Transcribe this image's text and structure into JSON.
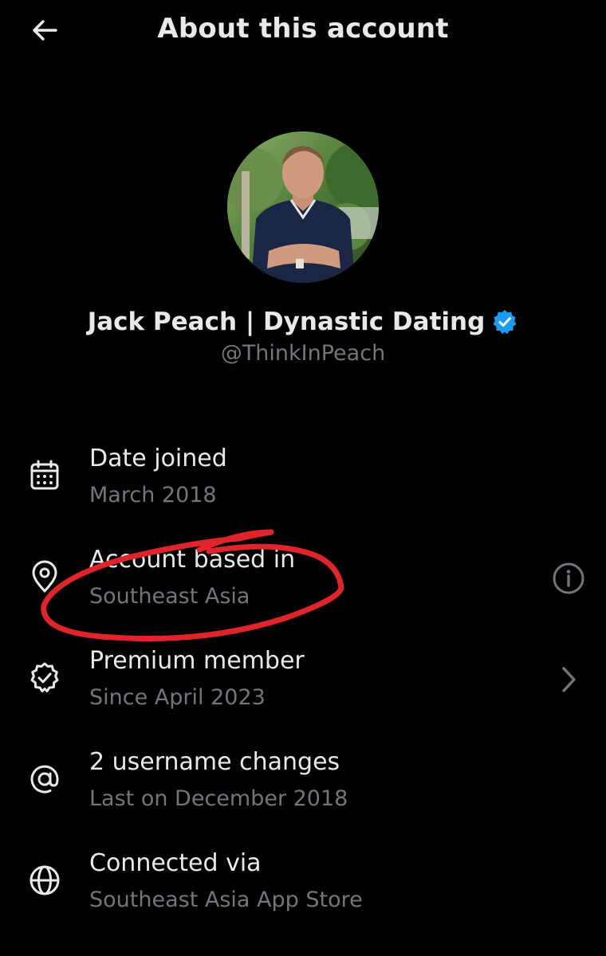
{
  "header": {
    "title": "About this account",
    "back_icon": "arrow-left-icon"
  },
  "profile": {
    "display_name": "Jack Peach | Dynastic Dating",
    "handle": "@ThinkInPeach",
    "verified": true,
    "verified_color": "#1d9bf0"
  },
  "details": [
    {
      "icon": "calendar-icon",
      "title": "Date joined",
      "subtitle": "March 2018",
      "action_icon": ""
    },
    {
      "icon": "location-pin-icon",
      "title": "Account based in",
      "subtitle": "Southeast Asia",
      "action_icon": "info-icon"
    },
    {
      "icon": "verified-seal-icon",
      "title": "Premium member",
      "subtitle": "Since April 2023",
      "action_icon": "chevron-right-icon"
    },
    {
      "icon": "at-sign-icon",
      "title": "2 username changes",
      "subtitle": "Last on December 2018",
      "action_icon": ""
    },
    {
      "icon": "globe-icon",
      "title": "Connected via",
      "subtitle": "Southeast Asia App Store",
      "action_icon": ""
    }
  ],
  "colors": {
    "background": "#000000",
    "primary_text": "#e7e9ea",
    "secondary_text": "#71767b",
    "annotation": "#e0242b"
  }
}
